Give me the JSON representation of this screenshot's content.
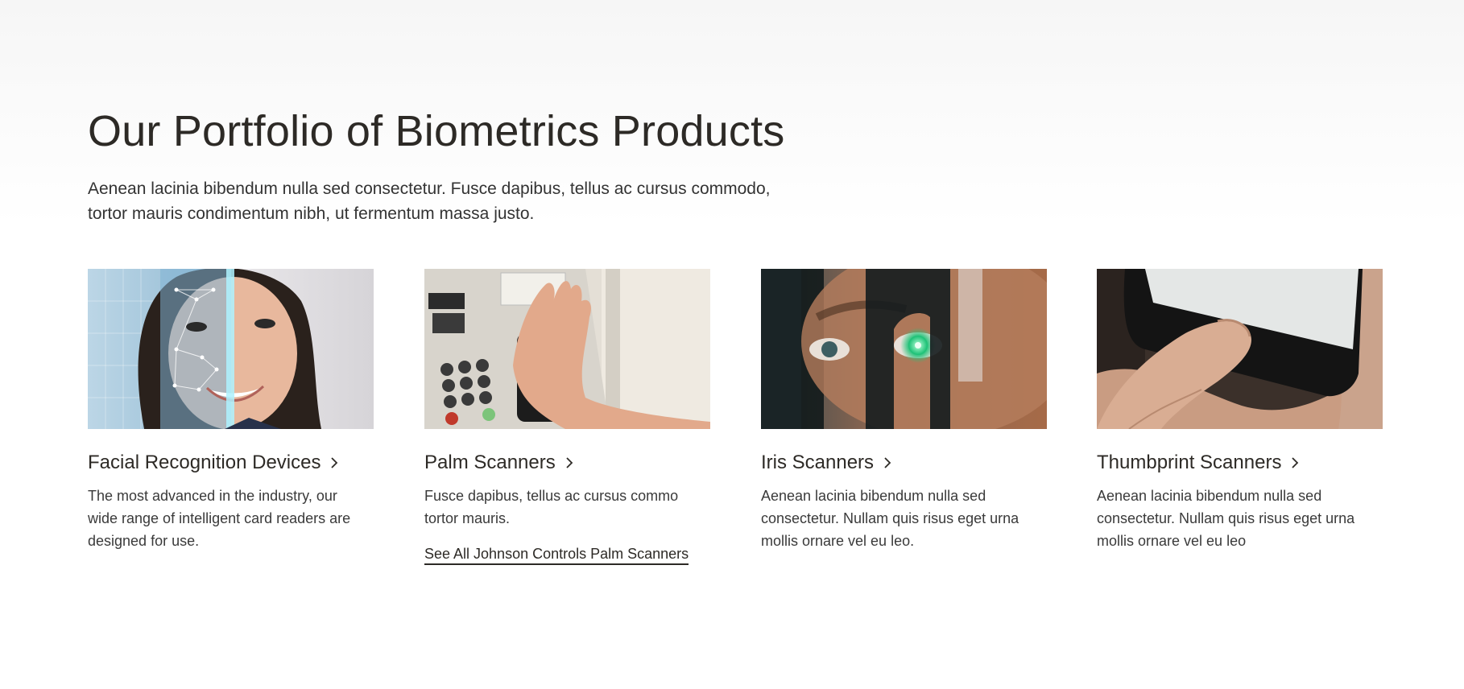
{
  "section": {
    "title": "Our Portfolio of Biometrics Products",
    "intro": "Aenean lacinia bibendum nulla sed consectetur. Fusce dapibus, tellus ac cursus commodo, tortor mauris condimentum nibh, ut fermentum massa justo."
  },
  "cards": [
    {
      "title": "Facial Recognition Devices",
      "description": "The most advanced in the industry, our wide range of intelligent card readers are designed for use.",
      "icon": "chevron-right-icon"
    },
    {
      "title": "Palm Scanners",
      "description": "Fusce dapibus, tellus ac cursus commo tortor mauris.",
      "link": "See All Johnson Controls Palm Scanners",
      "icon": "chevron-right-icon"
    },
    {
      "title": "Iris Scanners",
      "description": "Aenean lacinia bibendum nulla sed consectetur. Nullam quis risus eget urna mollis ornare vel eu leo.",
      "icon": "chevron-right-icon"
    },
    {
      "title": "Thumbprint Scanners",
      "description": "Aenean lacinia bibendum nulla sed consectetur. Nullam quis risus eget urna mollis ornare vel eu leo",
      "icon": "chevron-right-icon"
    }
  ],
  "colors": {
    "text": "#2d2a26",
    "background_top": "#f6f6f6",
    "background_bottom": "#ffffff"
  }
}
